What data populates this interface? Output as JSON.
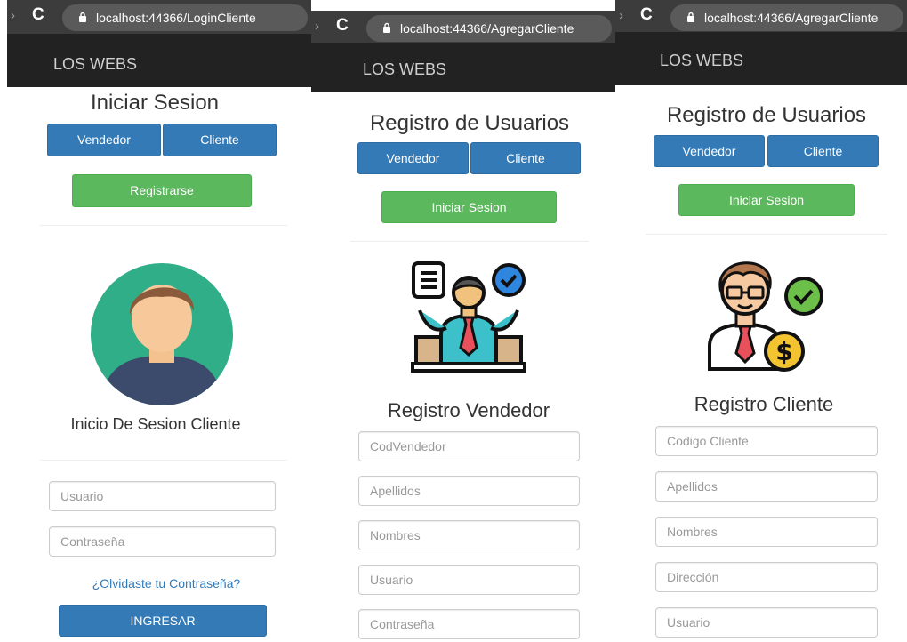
{
  "panels": [
    {
      "url": "localhost:44366/LoginCliente",
      "brand": "LOS WEBS",
      "title": "Iniciar Sesion",
      "tabs": [
        "Vendedor",
        "Cliente"
      ],
      "action_button": "Registrarse",
      "subtitle": "Inicio De Sesion Cliente",
      "fields": [
        {
          "placeholder": "Usuario"
        },
        {
          "placeholder": "Contraseña"
        }
      ],
      "forgot_link": "¿Olvidaste tu Contraseña?",
      "submit_button": "INGRESAR"
    },
    {
      "url": "localhost:44366/AgregarCliente",
      "brand": "LOS WEBS",
      "title": "Registro de Usuarios",
      "tabs": [
        "Vendedor",
        "Cliente"
      ],
      "action_button": "Iniciar Sesion",
      "subtitle": "Registro Vendedor",
      "fields": [
        {
          "placeholder": "CodVendedor"
        },
        {
          "placeholder": "Apellidos"
        },
        {
          "placeholder": "Nombres"
        },
        {
          "placeholder": "Usuario"
        },
        {
          "placeholder": "Contraseña"
        }
      ]
    },
    {
      "url": "localhost:44366/AgregarCliente",
      "brand": "LOS WEBS",
      "title": "Registro de Usuarios",
      "tabs": [
        "Vendedor",
        "Cliente"
      ],
      "action_button": "Iniciar Sesion",
      "subtitle": "Registro Cliente",
      "fields": [
        {
          "placeholder": "Codigo Cliente"
        },
        {
          "placeholder": "Apellidos"
        },
        {
          "placeholder": "Nombres"
        },
        {
          "placeholder": "Dirección"
        },
        {
          "placeholder": "Usuario"
        }
      ]
    }
  ],
  "colors": {
    "primary": "#337ab7",
    "success": "#5cb85c",
    "navbar": "#222222",
    "chrome": "#3c3c3c",
    "avatar_bg": "#2fae88",
    "icon_teal": "#3cc0c9",
    "icon_blue": "#2e86de"
  }
}
